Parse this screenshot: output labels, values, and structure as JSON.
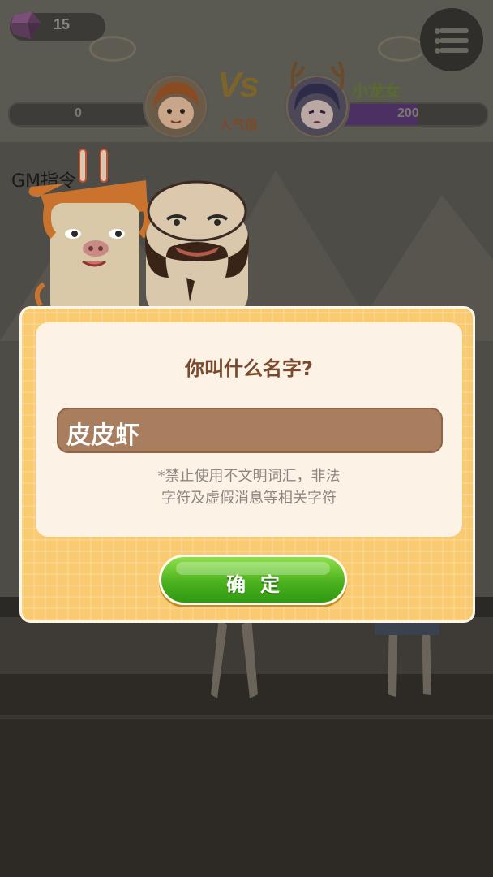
{
  "hud": {
    "gem_count": "15",
    "left_score": "0",
    "right_score": "200",
    "right_score_fraction": 0.55,
    "vs": "Vs",
    "popularity_label": "人气值",
    "opponent_name": "小龙女"
  },
  "background": {
    "gm_label": "GM指令"
  },
  "dialog": {
    "title": "你叫什么名字?",
    "name_value": "皮皮虾",
    "hint_line1": "*禁止使用不文明词汇，非法",
    "hint_line2": "字符及虚假消息等相关字符",
    "confirm_label": "确定"
  },
  "colors": {
    "dialog_frame": "#f9ca70",
    "panel": "#fdf2e6",
    "input_bg": "#a97e5f",
    "button_green": "#4cb21e",
    "title_brown": "#7a4a2e"
  },
  "icons": [
    "gem-icon",
    "menu-icon",
    "player-avatar-icon",
    "opponent-avatar-icon"
  ]
}
